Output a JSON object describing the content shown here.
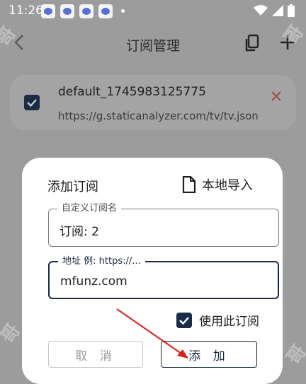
{
  "status_bar": {
    "time": "11:26"
  },
  "header": {
    "title": "订阅管理"
  },
  "subscription": {
    "name": "default_1745983125775",
    "url": "https://g.staticanalyzer.com/tv/tv.json"
  },
  "dialog": {
    "title": "添加订阅",
    "import_label": "本地导入",
    "name_field": {
      "label": "自定义订阅名",
      "value": "订阅: 2"
    },
    "address_field": {
      "label": "地址 例: https://...",
      "value": "mfunz.com"
    },
    "use_checkbox_label": "使用此订阅",
    "cancel_label": "取 消",
    "add_label": "添 加"
  },
  "colors": {
    "accent": "#1b2b46",
    "delete": "#c0392b",
    "annotation_arrow": "#e0201b"
  },
  "icons": [
    "baidu-notification-icon",
    "wifi-icon",
    "signal-icon",
    "battery-icon",
    "back-icon",
    "paste-icon",
    "add-icon",
    "checkbox-icon",
    "close-icon",
    "file-icon",
    "check-icon"
  ]
}
